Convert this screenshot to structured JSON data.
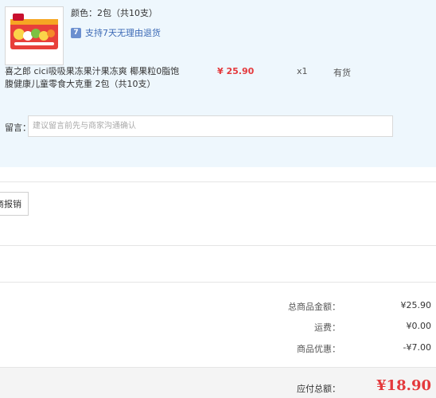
{
  "item": {
    "spec": "颜色：2包（共10支）",
    "service": "支持7天无理由退货",
    "service_icon": "7",
    "title": "喜之郎 cici吸吸果冻果汁果冻爽 椰果粒0脂饱腹健康儿童零食大克重 2包（共10支）",
    "price": "¥ 25.90",
    "quantity": "x1",
    "stock": "有货",
    "product_image_icon": "product-thumbnail-icon"
  },
  "remark": {
    "label": "留言：",
    "placeholder": "建议留言前先与商家沟通确认"
  },
  "invoice": {
    "button_label": "商报销"
  },
  "summary": {
    "total_label": "总商品金额：",
    "total_value": "¥25.90",
    "shipping_label": "运费：",
    "shipping_value": "¥0.00",
    "discount_label": "商品优惠：",
    "discount_value": "-¥7.00"
  },
  "payable": {
    "label": "应付总额：",
    "value": "¥18.90"
  },
  "colors": {
    "item_bg": "#eef7fd",
    "price_red": "#e4393c",
    "link_blue": "#3b69b5"
  }
}
